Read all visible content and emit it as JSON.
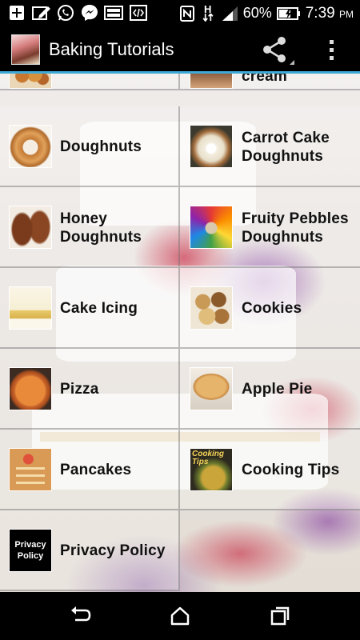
{
  "status_bar": {
    "battery_percent": "60%",
    "time": "7:39",
    "time_suffix": "PM",
    "network_label": "H",
    "icons": [
      "add-icon",
      "edit-icon",
      "whatsapp-icon",
      "messenger-icon",
      "gallery-icon",
      "code-icon",
      "nfc-icon",
      "data-arrows-icon",
      "signal-icon",
      "battery-icon"
    ]
  },
  "app_bar": {
    "title": "Baking Tutorials",
    "icons": [
      "app-logo",
      "share-icon",
      "overflow-menu-icon"
    ]
  },
  "grid": {
    "items": [
      {
        "label": "",
        "thumb": "truffles-thumb"
      },
      {
        "label": "cream",
        "thumb": "ice-cream-thumb"
      },
      {
        "label": "Doughnuts",
        "thumb": "doughnut-thumb"
      },
      {
        "label": "Carrot Cake Doughnuts",
        "thumb": "carrot-cake-doughnut-thumb"
      },
      {
        "label": "Honey Doughnuts",
        "thumb": "honey-doughnut-thumb"
      },
      {
        "label": "Fruity Pebbles Doughnuts",
        "thumb": "fruity-pebbles-doughnut-thumb"
      },
      {
        "label": "Cake Icing",
        "thumb": "cake-icing-thumb"
      },
      {
        "label": "Cookies",
        "thumb": "cookies-thumb"
      },
      {
        "label": "Pizza",
        "thumb": "pizza-thumb"
      },
      {
        "label": "Apple Pie",
        "thumb": "apple-pie-thumb"
      },
      {
        "label": "Pancakes",
        "thumb": "pancakes-thumb"
      },
      {
        "label": "Cooking Tips",
        "thumb": "cooking-tips-thumb",
        "thumb_text": "Cooking Tips"
      },
      {
        "label": "Privacy Policy",
        "thumb": "privacy-policy-thumb",
        "thumb_text_1": "Privacy",
        "thumb_text_2": "Policy"
      }
    ]
  },
  "nav_bar": {
    "icons": [
      "back-icon",
      "home-icon",
      "recents-icon"
    ]
  },
  "colors": {
    "accent": "#3ea9d4",
    "bar_background": "#000000",
    "label_text": "#111111"
  }
}
